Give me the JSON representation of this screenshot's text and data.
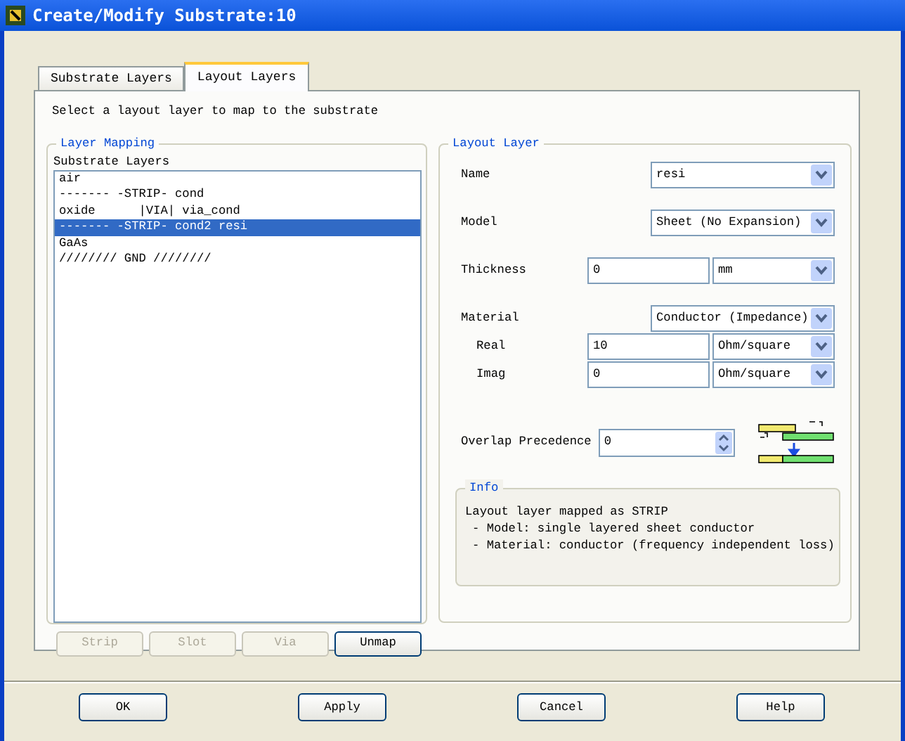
{
  "window": {
    "title": "Create/Modify Substrate:10"
  },
  "tabs": [
    {
      "label": "Substrate Layers",
      "selected": false
    },
    {
      "label": "Layout Layers",
      "selected": true
    }
  ],
  "instruction": "Select a layout layer to map to the substrate",
  "layer_mapping": {
    "title": "Layer Mapping",
    "list_label": "Substrate Layers",
    "items": [
      {
        "text": "air",
        "selected": false
      },
      {
        "text": "------- -STRIP- cond",
        "selected": false
      },
      {
        "text": "oxide      |VIA| via_cond",
        "selected": false
      },
      {
        "text": "------- -STRIP- cond2 resi",
        "selected": true
      },
      {
        "text": "GaAs",
        "selected": false
      },
      {
        "text": "//////// GND ////////",
        "selected": false
      }
    ],
    "buttons": [
      {
        "label": "Strip",
        "disabled": true
      },
      {
        "label": "Slot",
        "disabled": true
      },
      {
        "label": "Via",
        "disabled": true
      },
      {
        "label": "Unmap",
        "disabled": false
      }
    ]
  },
  "layout_layer": {
    "title": "Layout Layer",
    "fields": [
      {
        "kind": "combo",
        "label": "Name",
        "value": "resi"
      },
      {
        "kind": "combo",
        "label": "Model",
        "value": "Sheet (No Expansion)"
      },
      {
        "kind": "unit",
        "label": "Thickness",
        "value": "0",
        "unit": "mm"
      },
      {
        "kind": "combo",
        "label": "Material",
        "value": "Conductor (Impedance)"
      },
      {
        "kind": "subunit",
        "label": "Real",
        "value": "10",
        "unit": "Ohm/square"
      },
      {
        "kind": "subunit",
        "label": "Imag",
        "value": "0",
        "unit": "Ohm/square"
      },
      {
        "kind": "spin",
        "label": "Overlap Precedence",
        "value": "0"
      }
    ],
    "info": {
      "title": "Info",
      "heading": "Layout layer mapped as STRIP",
      "points": [
        "- Model: single layered sheet conductor",
        "- Material: conductor (frequency independent loss)"
      ]
    }
  },
  "dialog_buttons": [
    "OK",
    "Apply",
    "Cancel",
    "Help"
  ]
}
